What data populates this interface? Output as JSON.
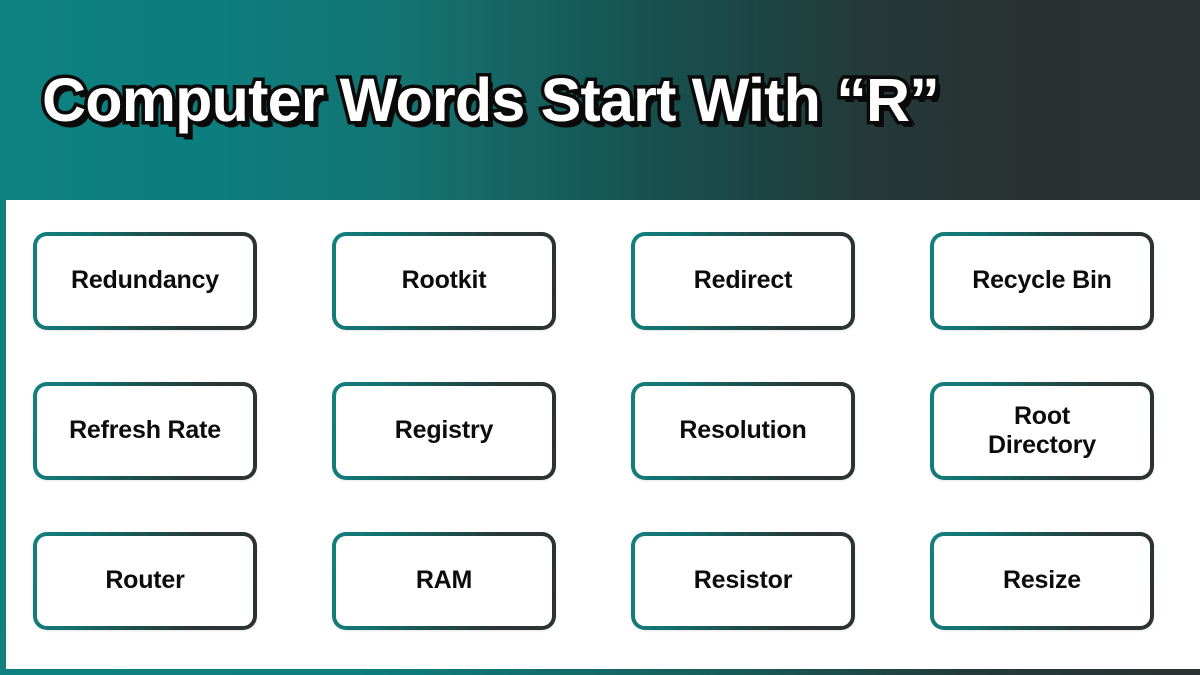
{
  "header": {
    "title": "Computer Words Start With “R”",
    "gradient_start": "#0d8080",
    "gradient_mid": "#17504e",
    "gradient_end": "#2c3232",
    "title_color": "#ffffff",
    "title_outline_color": "#0a0a0a"
  },
  "theme": {
    "accent_teal": "#0d8080",
    "accent_dark": "#2c3232",
    "box_background": "#ffffff",
    "word_text_color": "#0c0c0c",
    "page_background": "#ffffff"
  },
  "grid": {
    "columns": 4,
    "rows": 3,
    "words": [
      {
        "label": "Redundancy"
      },
      {
        "label": "Rootkit"
      },
      {
        "label": "Redirect"
      },
      {
        "label": "Recycle Bin"
      },
      {
        "label": "Refresh Rate"
      },
      {
        "label": "Registry"
      },
      {
        "label": "Resolution"
      },
      {
        "label": "Root\nDirectory"
      },
      {
        "label": "Router"
      },
      {
        "label": "RAM"
      },
      {
        "label": "Resistor"
      },
      {
        "label": "Resize"
      }
    ]
  }
}
